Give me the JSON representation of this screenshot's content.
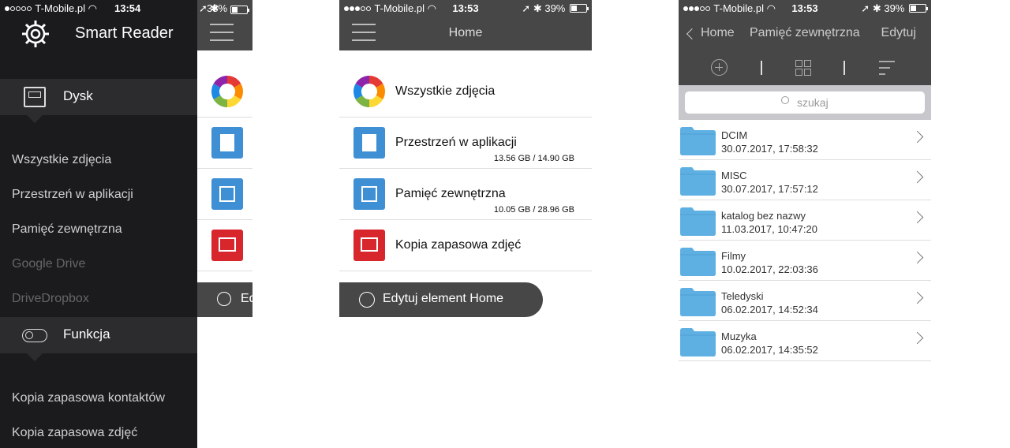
{
  "screen1": {
    "status": {
      "carrier": "T-Mobile.pl",
      "time": "13:54",
      "battery": "38%",
      "battery_level": 0.38,
      "signal_bars": 1
    },
    "app_title": "Smart Reader",
    "disk_label": "Dysk",
    "menu": [
      "Wszystkie zdjęcia",
      "Przestrzeń w aplikacji",
      "Pamięć zewnętrzna"
    ],
    "disabled_menu": [
      "Google Drive",
      "DriveDropbox"
    ],
    "function_label": "Funkcja",
    "function_menu": [
      "Kopia zapasowa kontaktów",
      "Kopia zapasowa zdjęć"
    ],
    "peek_button": "Ed"
  },
  "screen2": {
    "status": {
      "carrier": "T-Mobile.pl",
      "time": "13:53",
      "battery": "39%",
      "battery_level": 0.39,
      "signal_bars": 3
    },
    "title": "Home",
    "items": [
      {
        "label": "Wszystkie zdjęcia",
        "size": ""
      },
      {
        "label": "Przestrzeń w aplikacji",
        "size": "13.56 GB / 14.90 GB"
      },
      {
        "label": "Pamięć zewnętrzna",
        "size": "10.05 GB / 28.96 GB"
      },
      {
        "label": "Kopia zapasowa zdjęć",
        "size": ""
      }
    ],
    "edit_button": "Edytuj element Home"
  },
  "screen3": {
    "status": {
      "carrier": "T-Mobile.pl",
      "time": "13:53",
      "battery": "39%",
      "battery_level": 0.39,
      "signal_bars": 3
    },
    "back_label": "Home",
    "title": "Pamięć zewnętrzna",
    "edit_label": "Edytuj",
    "search_placeholder": "szukaj",
    "folders": [
      {
        "name": "DCIM",
        "date": "30.07.2017, 17:58:32"
      },
      {
        "name": "MISC",
        "date": "30.07.2017, 17:57:12"
      },
      {
        "name": "katalog bez nazwy",
        "date": "11.03.2017, 10:47:20"
      },
      {
        "name": "Filmy",
        "date": "10.02.2017, 22:03:36"
      },
      {
        "name": "Teledyski",
        "date": "06.02.2017, 14:52:34"
      },
      {
        "name": "Muzyka",
        "date": "06.02.2017, 14:35:52"
      }
    ]
  },
  "colors": {
    "nav_bg": "#474747",
    "sidebar_bg": "#1b1b1d",
    "folder_blue": "#5fb0e2",
    "photo_red": "#d8262d",
    "doc_blue": "#3f8fd4"
  }
}
